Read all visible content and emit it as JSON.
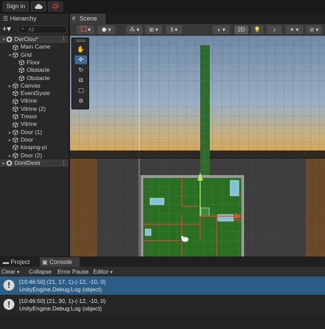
{
  "topbar": {
    "signin": "Sign in"
  },
  "hierarchy": {
    "tab": "Hierarchy",
    "search_placeholder": "All",
    "items": [
      {
        "label": "DerClou*",
        "icon": "unity-scene-icon",
        "arrow": "▾",
        "depth": 0
      },
      {
        "label": "Main Came",
        "icon": "camera-icon",
        "arrow": "",
        "depth": 1
      },
      {
        "label": "Grid",
        "icon": "cube-icon",
        "arrow": "▾",
        "depth": 1
      },
      {
        "label": "Floor",
        "icon": "cube-icon",
        "arrow": "",
        "depth": 2
      },
      {
        "label": "Obstacle",
        "icon": "cube-icon",
        "arrow": "",
        "depth": 2
      },
      {
        "label": "Obstacle",
        "icon": "cube-icon",
        "arrow": "",
        "depth": 2
      },
      {
        "label": "Canvas",
        "icon": "cube-icon",
        "arrow": "▸",
        "depth": 1
      },
      {
        "label": "EventSyste",
        "icon": "cube-icon",
        "arrow": "",
        "depth": 1
      },
      {
        "label": "Vitrine",
        "icon": "cube-icon",
        "arrow": "",
        "depth": 1
      },
      {
        "label": "Vitrine (2)",
        "icon": "cube-icon",
        "arrow": "",
        "depth": 1
      },
      {
        "label": "Tresor",
        "icon": "cube-icon",
        "arrow": "",
        "depth": 1
      },
      {
        "label": "Vitrine",
        "icon": "cube-icon",
        "arrow": "",
        "depth": 1
      },
      {
        "label": "Door (1)",
        "icon": "cube-icon",
        "arrow": "▸",
        "depth": 1
      },
      {
        "label": "Door",
        "icon": "cube-icon",
        "arrow": "▸",
        "depth": 1
      },
      {
        "label": "kisspng-pi",
        "icon": "cube-icon",
        "arrow": "",
        "depth": 1
      },
      {
        "label": "Door (2)",
        "icon": "cube-icon",
        "arrow": "▸",
        "depth": 1
      },
      {
        "label": "DontDestr",
        "icon": "unity-scene-icon",
        "arrow": "▸",
        "depth": 0
      }
    ]
  },
  "scene": {
    "tab": "Scene",
    "toggle_2d": "2D",
    "tools": [
      "hand-tool-icon",
      "move-tool-icon",
      "rotate-tool-icon",
      "scale-tool-icon",
      "rect-tool-icon",
      "transform-tool-icon"
    ]
  },
  "console": {
    "tabs": [
      "Project",
      "Console"
    ],
    "toolbar": {
      "clear": "Clear",
      "collapse": "Collapse",
      "error_pause": "Error Pause",
      "editor": "Editor"
    },
    "messages": [
      {
        "line1": "[10:46:50] (21, 17, 1)-(-12, -10, 0)",
        "line2": "UnityEngine.Debug:Log (object)",
        "selected": true
      },
      {
        "line1": "[10:46:50] (21, 30, 1)-(-12, -10, 0)",
        "line2": "UnityEngine.Debug:Log (object)",
        "selected": false
      }
    ]
  },
  "colors": {
    "selection": "#2c5d87",
    "floor_green": "#2a6e22",
    "panel_bg": "#282828"
  }
}
